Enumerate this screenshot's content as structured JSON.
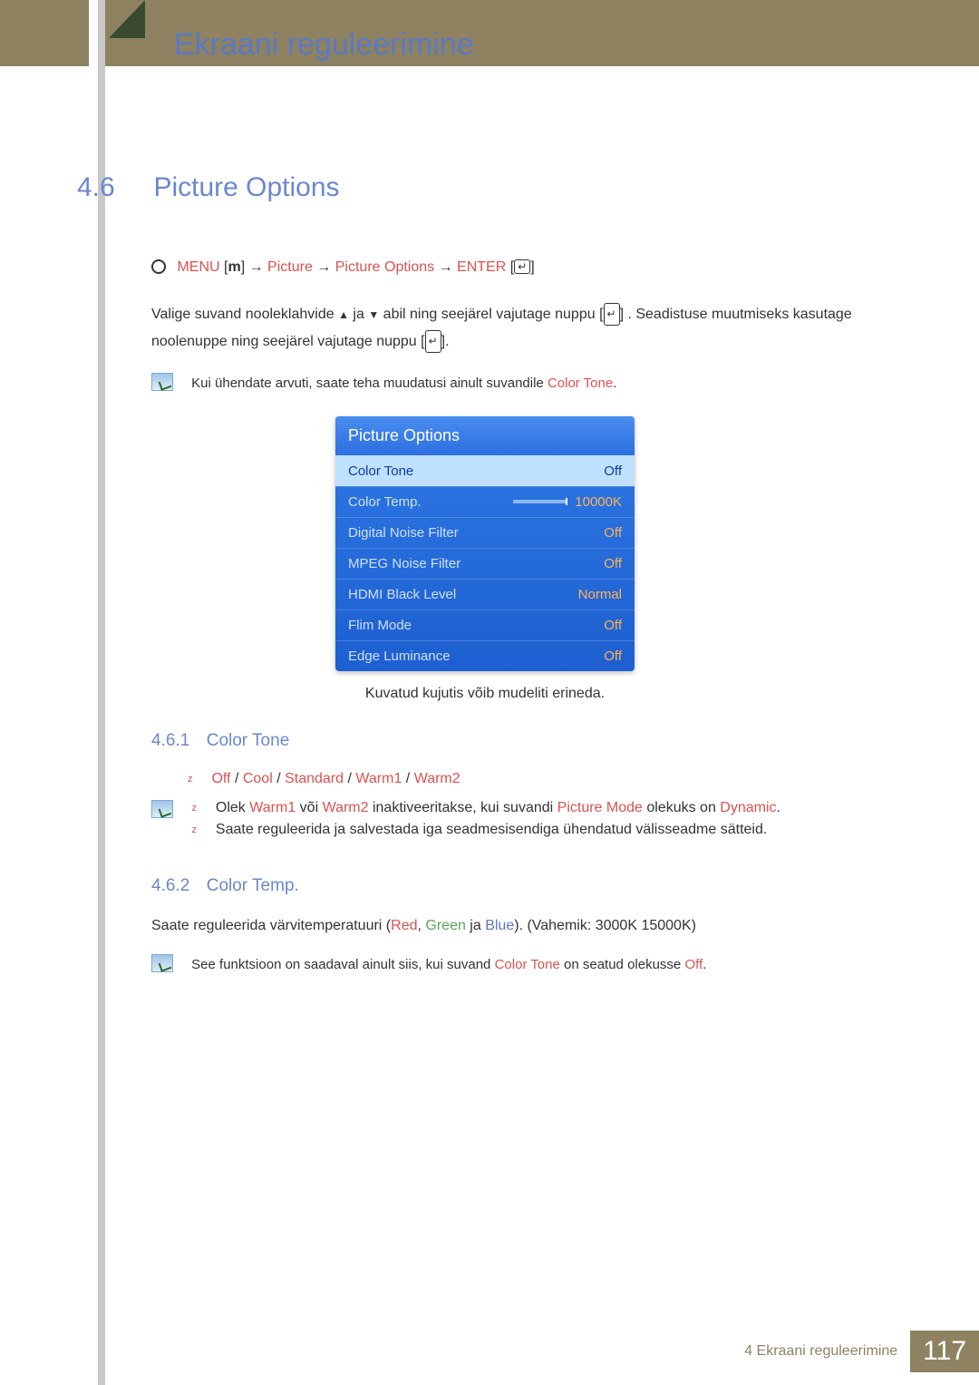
{
  "chapter": {
    "title": "Ekraani reguleerimine",
    "footer_label": "4 Ekraani reguleerimine",
    "number": "4"
  },
  "page_number": "117",
  "section": {
    "num": "4.6",
    "title": "Picture Options"
  },
  "nav": {
    "menu": "MENU",
    "m": "m",
    "arrow": "→",
    "p1": "Picture",
    "p2": "Picture Options",
    "enter": "ENTER"
  },
  "intro_para_1a": "Valige suvand nooleklahvide",
  "intro_para_1b": "ja",
  "intro_para_1c": "abil ning seejärel vajutage nuppu",
  "intro_para_1d": ". Seadistuse muutmiseks kasutage noolenuppe ning seejärel vajutage nuppu",
  "intro_para_1e": ".",
  "note1_a": "Kui ühendate arvuti, saate teha muudatusi ainult suvandile",
  "note1_b": "Color Tone",
  "note1_c": ".",
  "osd": {
    "title": "Picture Options",
    "rows": [
      {
        "label": "Color Tone",
        "value": "Off",
        "selected": true
      },
      {
        "label": "Color Temp.",
        "value": "10000K",
        "slider": true
      },
      {
        "label": "Digital Noise Filter",
        "value": "Off"
      },
      {
        "label": "MPEG Noise Filter",
        "value": "Off"
      },
      {
        "label": "HDMI Black Level",
        "value": "Normal"
      },
      {
        "label": "Flim Mode",
        "value": "Off"
      },
      {
        "label": "Edge Luminance",
        "value": "Off"
      }
    ]
  },
  "osd_caption": "Kuvatud kujutis võib mudeliti erineda.",
  "sub1": {
    "num": "4.6.1",
    "title": "Color Tone",
    "opts": {
      "off": "Off",
      "cool": "Cool",
      "standard": "Standard",
      "warm1": "Warm1",
      "warm2": "Warm2",
      "sep": " / "
    },
    "n1_a": "Olek ",
    "n1_b": "Warm1",
    "n1_c": " või ",
    "n1_d": "Warm2",
    "n1_e": " inaktiveeritakse, kui suvandi",
    "n1_f": "Picture Mode",
    "n1_g": " olekuks on ",
    "n1_h": "Dynamic",
    "n1_i": ".",
    "n2": "Saate reguleerida ja salvestada iga seadmesisendiga ühendatud välisseadme sätteid."
  },
  "sub2": {
    "num": "4.6.2",
    "title": "Color Temp.",
    "p_a": "Saate reguleerida värvitemperatuuri (",
    "p_red": "Red",
    "p_c1": ", ",
    "p_green": "Green",
    "p_c2": " ja ",
    "p_blue": "Blue",
    "p_b": "). (Vahemik: 3000K 15000K)",
    "note_a": "See funktsioon on saadaval ainult siis, kui suvand",
    "note_b": "Color Tone",
    "note_c": " on seatud olekusse ",
    "note_d": "Off",
    "note_e": "."
  }
}
